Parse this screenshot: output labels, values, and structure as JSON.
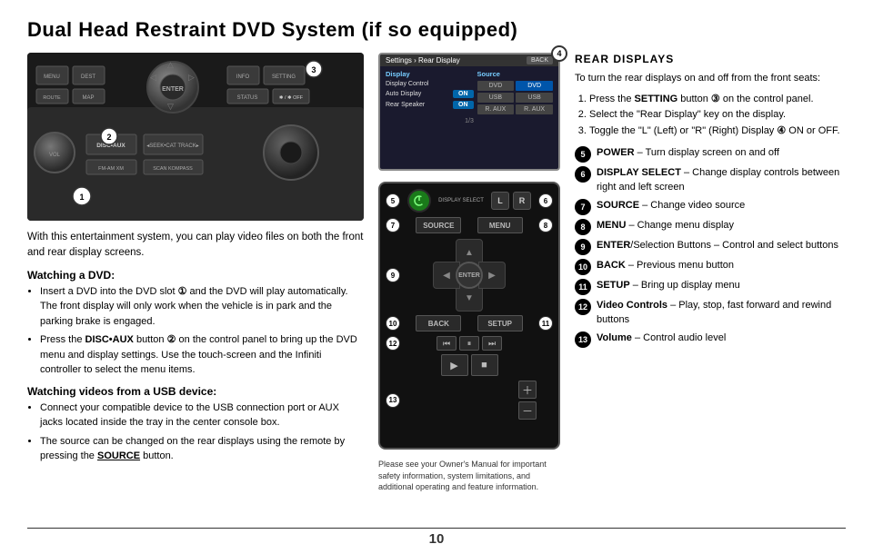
{
  "page": {
    "title": "Dual Head Restraint DVD System (if so equipped)",
    "page_number": "10"
  },
  "left": {
    "intro": "With this entertainment system, you can play video files on both the front and rear display screens.",
    "section1_title": "Watching a DVD:",
    "section1_bullets": [
      "Insert a DVD into the DVD slot 1 and the DVD will play automatically. The front display will only work when the vehicle is in park and the parking brake is engaged.",
      "Press the DISC•AUX button 2 on the control panel to bring up the DVD menu and display settings. Use the touch-screen and the Infiniti controller to select the menu items."
    ],
    "section2_title": "Watching videos from a USB device:",
    "section2_bullets": [
      "Connect your compatible device to the USB connection port or AUX jacks located inside the tray in the center console box.",
      "The source can be changed on the rear displays using the remote by pressing the SOURCE button."
    ],
    "bold_terms": [
      "DISC•AUX",
      "SOURCE"
    ]
  },
  "screen": {
    "breadcrumb": "Settings › Rear Display",
    "badge": "4",
    "back_label": "BACK",
    "display_control_label": "Display Control",
    "auto_display_label": "Auto Display",
    "auto_display_value": "ON",
    "rear_speaker_label": "Rear Speaker",
    "rear_speaker_value": "ON",
    "source_label": "Source",
    "page_indicator": "1/3",
    "sources": [
      "DVD",
      "DVD",
      "USB",
      "USB",
      "R. AUX",
      "R. AUX"
    ]
  },
  "remote": {
    "badge_5": "5",
    "badge_6": "6",
    "badge_7": "7",
    "badge_8": "8",
    "badge_9": "9",
    "badge_10": "10",
    "badge_11": "11",
    "badge_12": "12",
    "badge_13": "13",
    "display_select_label": "DISPLAY SELECT",
    "lr_left": "L",
    "lr_right": "R",
    "source_label": "SOURCE",
    "menu_label": "MENU",
    "enter_label": "ENTER",
    "back_label": "BACK",
    "setup_label": "SETUP",
    "caption": "Please see your Owner's Manual for important safety information, system limitations, and additional operating and feature information."
  },
  "right": {
    "rear_displays_title": "REAR DISPLAYS",
    "rear_displays_intro": "To turn the rear displays on and off from the front seats:",
    "steps": [
      "Press the SETTING button 3 on the control panel.",
      "Select the \"Rear Display\" key on the display.",
      "Toggle the \"L\" (Left) or \"R\" (Right) Display 4 ON or OFF."
    ],
    "features": [
      {
        "badge": "5",
        "text": "POWER – Turn display screen on and off"
      },
      {
        "badge": "6",
        "text": "DISPLAY SELECT – Change display controls between right and left screen"
      },
      {
        "badge": "7",
        "text": "SOURCE – Change video source"
      },
      {
        "badge": "8",
        "text": "MENU – Change menu display"
      },
      {
        "badge": "9",
        "text": "ENTER/Selection Buttons – Control and select buttons"
      },
      {
        "badge": "10",
        "text": "BACK – Previous menu button"
      },
      {
        "badge": "11",
        "text": "SETUP – Bring up display menu"
      },
      {
        "badge": "12",
        "text": "Video Controls – Play, stop, fast forward and rewind buttons"
      },
      {
        "badge": "13",
        "text": "Volume – Control audio level"
      }
    ]
  }
}
